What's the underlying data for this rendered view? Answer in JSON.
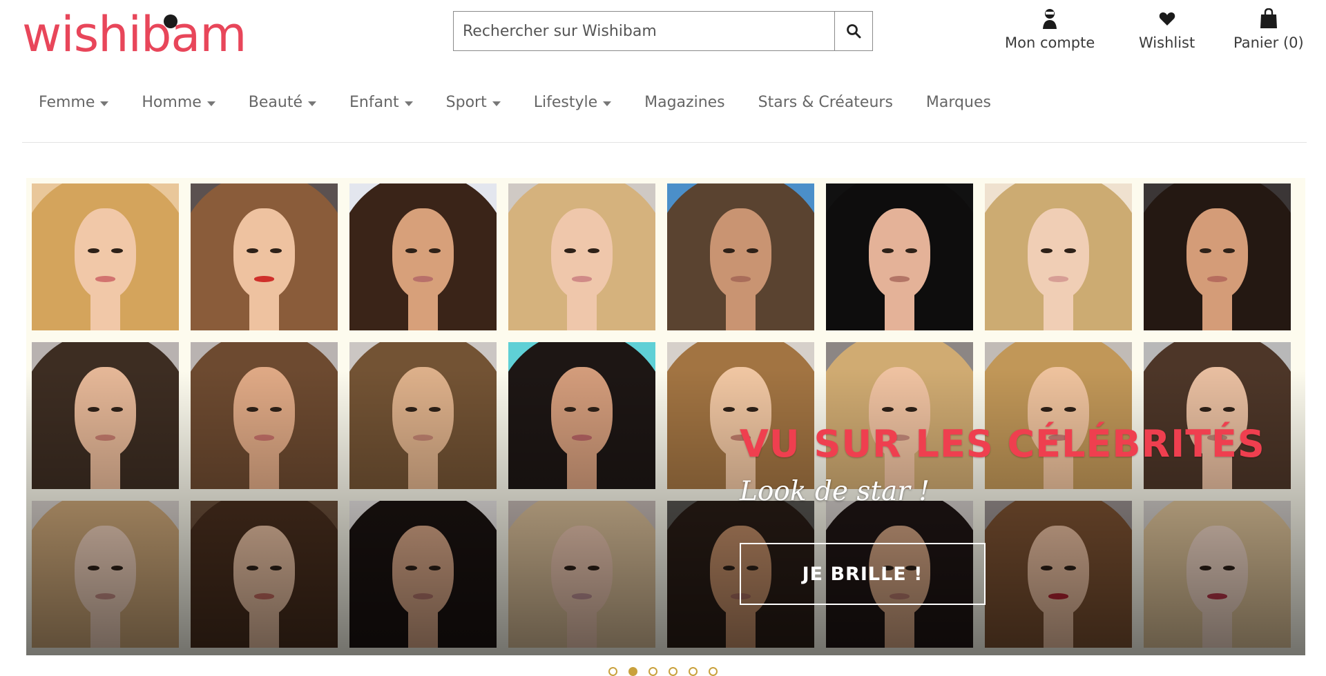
{
  "brand": {
    "logo_text": "wishibam",
    "accent": "#e8465a",
    "dot_color": "#1b1b1b"
  },
  "search": {
    "placeholder": "Rechercher sur Wishibam",
    "value": "",
    "icon": "search-icon"
  },
  "account_links": [
    {
      "id": "account",
      "label": "Mon compte",
      "icon": "user-icon"
    },
    {
      "id": "wishlist",
      "label": "Wishlist",
      "icon": "heart-icon"
    },
    {
      "id": "cart",
      "label": "Panier (0)",
      "icon": "shopping-bag-icon"
    }
  ],
  "nav": {
    "items": [
      {
        "label": "Femme",
        "has_dropdown": true
      },
      {
        "label": "Homme",
        "has_dropdown": true
      },
      {
        "label": "Beauté",
        "has_dropdown": true
      },
      {
        "label": "Enfant",
        "has_dropdown": true
      },
      {
        "label": "Sport",
        "has_dropdown": true
      },
      {
        "label": "Lifestyle",
        "has_dropdown": true
      },
      {
        "label": "Magazines",
        "has_dropdown": false
      },
      {
        "label": "Stars & Créateurs",
        "has_dropdown": false
      },
      {
        "label": "Marques",
        "has_dropdown": false
      }
    ]
  },
  "hero": {
    "title": "VU SUR LES CÉLÉBRITÉS",
    "subtitle": "Look de star !",
    "cta_label": "JE BRILLE !",
    "title_color": "#ef3f4f",
    "tiles": [
      {
        "bg": "#e9c79a",
        "hair": "#d4a45c",
        "skin": "#f1c8a8",
        "lips": "#d2736f"
      },
      {
        "bg": "#5b5150",
        "hair": "#8a5c3a",
        "skin": "#eec2a0",
        "lips": "#cf2f2a"
      },
      {
        "bg": "#e3e6ee",
        "hair": "#3a2418",
        "skin": "#d7a07a",
        "lips": "#b8706a"
      },
      {
        "bg": "#cfc9c4",
        "hair": "#d5b27d",
        "skin": "#efc7ab",
        "lips": "#d08a87"
      },
      {
        "bg": "#4b8fc9",
        "hair": "#5a4330",
        "skin": "#c99472",
        "lips": "#a96d5a"
      },
      {
        "bg": "#111111",
        "hair": "#0e0d0d",
        "skin": "#e4b298",
        "lips": "#b37566"
      },
      {
        "bg": "#efe1cf",
        "hair": "#ccab72",
        "skin": "#f0ceb5",
        "lips": "#d79e95"
      },
      {
        "bg": "#3b3636",
        "hair": "#241812",
        "skin": "#d49c78",
        "lips": "#b66d5e"
      },
      {
        "bg": "#b8b2b0",
        "hair": "#3d2d22",
        "skin": "#e5b797",
        "lips": "#c47b6d"
      },
      {
        "bg": "#b9b3b1",
        "hair": "#6d4a30",
        "skin": "#dfa985",
        "lips": "#c47068"
      },
      {
        "bg": "#cbc6c3",
        "hair": "#735334",
        "skin": "#ddb08a",
        "lips": "#c08270"
      },
      {
        "bg": "#5fd0d6",
        "hair": "#1d1614",
        "skin": "#d39c7b",
        "lips": "#b56363"
      },
      {
        "bg": "#d6d0ca",
        "hair": "#a27442",
        "skin": "#f0c6a2",
        "lips": "#c07d6b"
      },
      {
        "bg": "#8c8684",
        "hair": "#d0ab72",
        "skin": "#efc2a1",
        "lips": "#c58a7b"
      },
      {
        "bg": "#c1bbb6",
        "hair": "#c19758",
        "skin": "#eec29d",
        "lips": "#c67c74"
      },
      {
        "bg": "#b8b8b8",
        "hair": "#4d3628",
        "skin": "#e8bea0",
        "lips": "#b98675"
      },
      {
        "bg": "#d9d2cd",
        "hair": "#cfa97a",
        "skin": "#f1d2bd",
        "lips": "#c68e85"
      },
      {
        "bg": "#6b4f3a",
        "hair": "#4a2f1e",
        "skin": "#ecc3a5",
        "lips": "#c56b5f"
      },
      {
        "bg": "#ebe7e6",
        "hair": "#1b1311",
        "skin": "#dcaa8a",
        "lips": "#b5776c"
      },
      {
        "bg": "#c8bcb7",
        "hair": "#dbc09a",
        "skin": "#ecc7b1",
        "lips": "#c09296"
      },
      {
        "bg": "#585652",
        "hair": "#2a1d16",
        "skin": "#c48f69",
        "lips": "#a86d5f"
      },
      {
        "bg": "#d8d2cf",
        "hair": "#201615",
        "skin": "#d7a785",
        "lips": "#b77a6c"
      },
      {
        "bg": "#9b9291",
        "hair": "#7d5232",
        "skin": "#eec2a3",
        "lips": "#b52431"
      },
      {
        "bg": "#d5d0cc",
        "hair": "#e0c59b",
        "skin": "#f2d8c7",
        "lips": "#b73648"
      }
    ]
  },
  "carousel": {
    "count": 6,
    "active_index": 1,
    "color": "#c9a13d"
  }
}
